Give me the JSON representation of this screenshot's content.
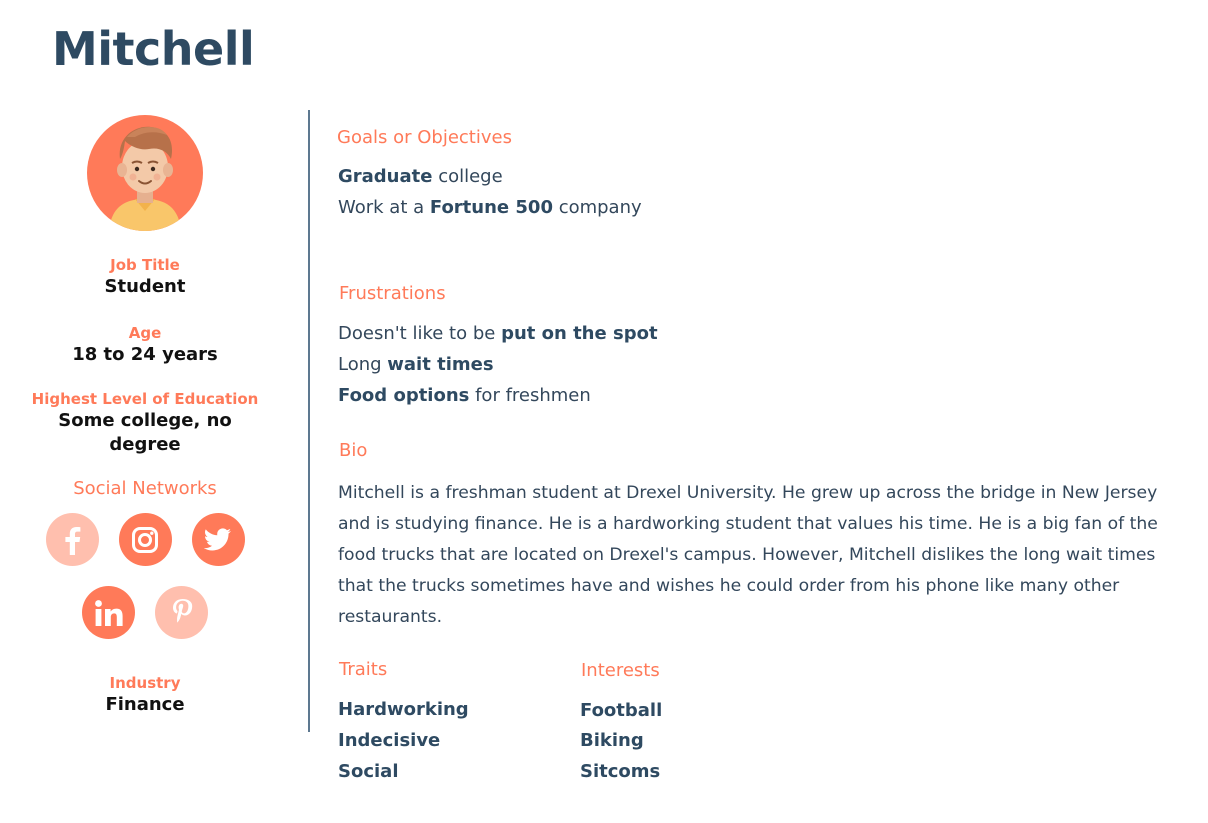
{
  "persona": {
    "name": "Mitchell"
  },
  "profile": {
    "job_title": {
      "label": "Job Title",
      "value": "Student"
    },
    "age": {
      "label": "Age",
      "value": "18 to 24 years"
    },
    "education": {
      "label": "Highest Level of Education",
      "value": "Some college, no degree"
    },
    "social_networks": {
      "label": "Social Networks",
      "icons": [
        {
          "name": "facebook-icon",
          "glyph": "f",
          "active": false
        },
        {
          "name": "instagram-icon",
          "glyph": "",
          "active": true
        },
        {
          "name": "twitter-icon",
          "glyph": "",
          "active": true
        },
        {
          "name": "linkedin-icon",
          "glyph": "in",
          "active": true
        },
        {
          "name": "pinterest-icon",
          "glyph": "P",
          "active": false
        }
      ]
    },
    "industry": {
      "label": "Industry",
      "value": "Finance"
    }
  },
  "goals": {
    "label": "Goals or Objectives",
    "items": [
      {
        "bold": "Graduate",
        "after": " college"
      },
      {
        "before": "Work at a ",
        "bold": "Fortune 500",
        "after": " company"
      }
    ]
  },
  "frustrations": {
    "label": "Frustrations",
    "items": [
      {
        "before": "Doesn't like to be ",
        "bold": "put on the spot"
      },
      {
        "before": "Long ",
        "bold": "wait times"
      },
      {
        "bold": "Food options",
        "after": " for freshmen"
      }
    ]
  },
  "bio": {
    "label": "Bio",
    "text": "Mitchell is a freshman student at Drexel University.  He grew up across the bridge in New Jersey and is studying finance. He is a hardworking student that values his time. He is a big fan of the food trucks that are located on Drexel's campus. However, Mitchell dislikes the long wait times that the trucks sometimes have and wishes he could order from his phone like many other restaurants."
  },
  "traits": {
    "label": "Traits",
    "items": [
      "Hardworking",
      "Indecisive",
      "Social"
    ]
  },
  "interests": {
    "label": "Interests",
    "items": [
      "Football",
      "Biking",
      "Sitcoms"
    ]
  },
  "colors": {
    "accent": "#ff7a59",
    "accent_light": "#ffbfae",
    "heading": "#2e4a62",
    "body": "#33475b",
    "divider": "#5d7890"
  }
}
